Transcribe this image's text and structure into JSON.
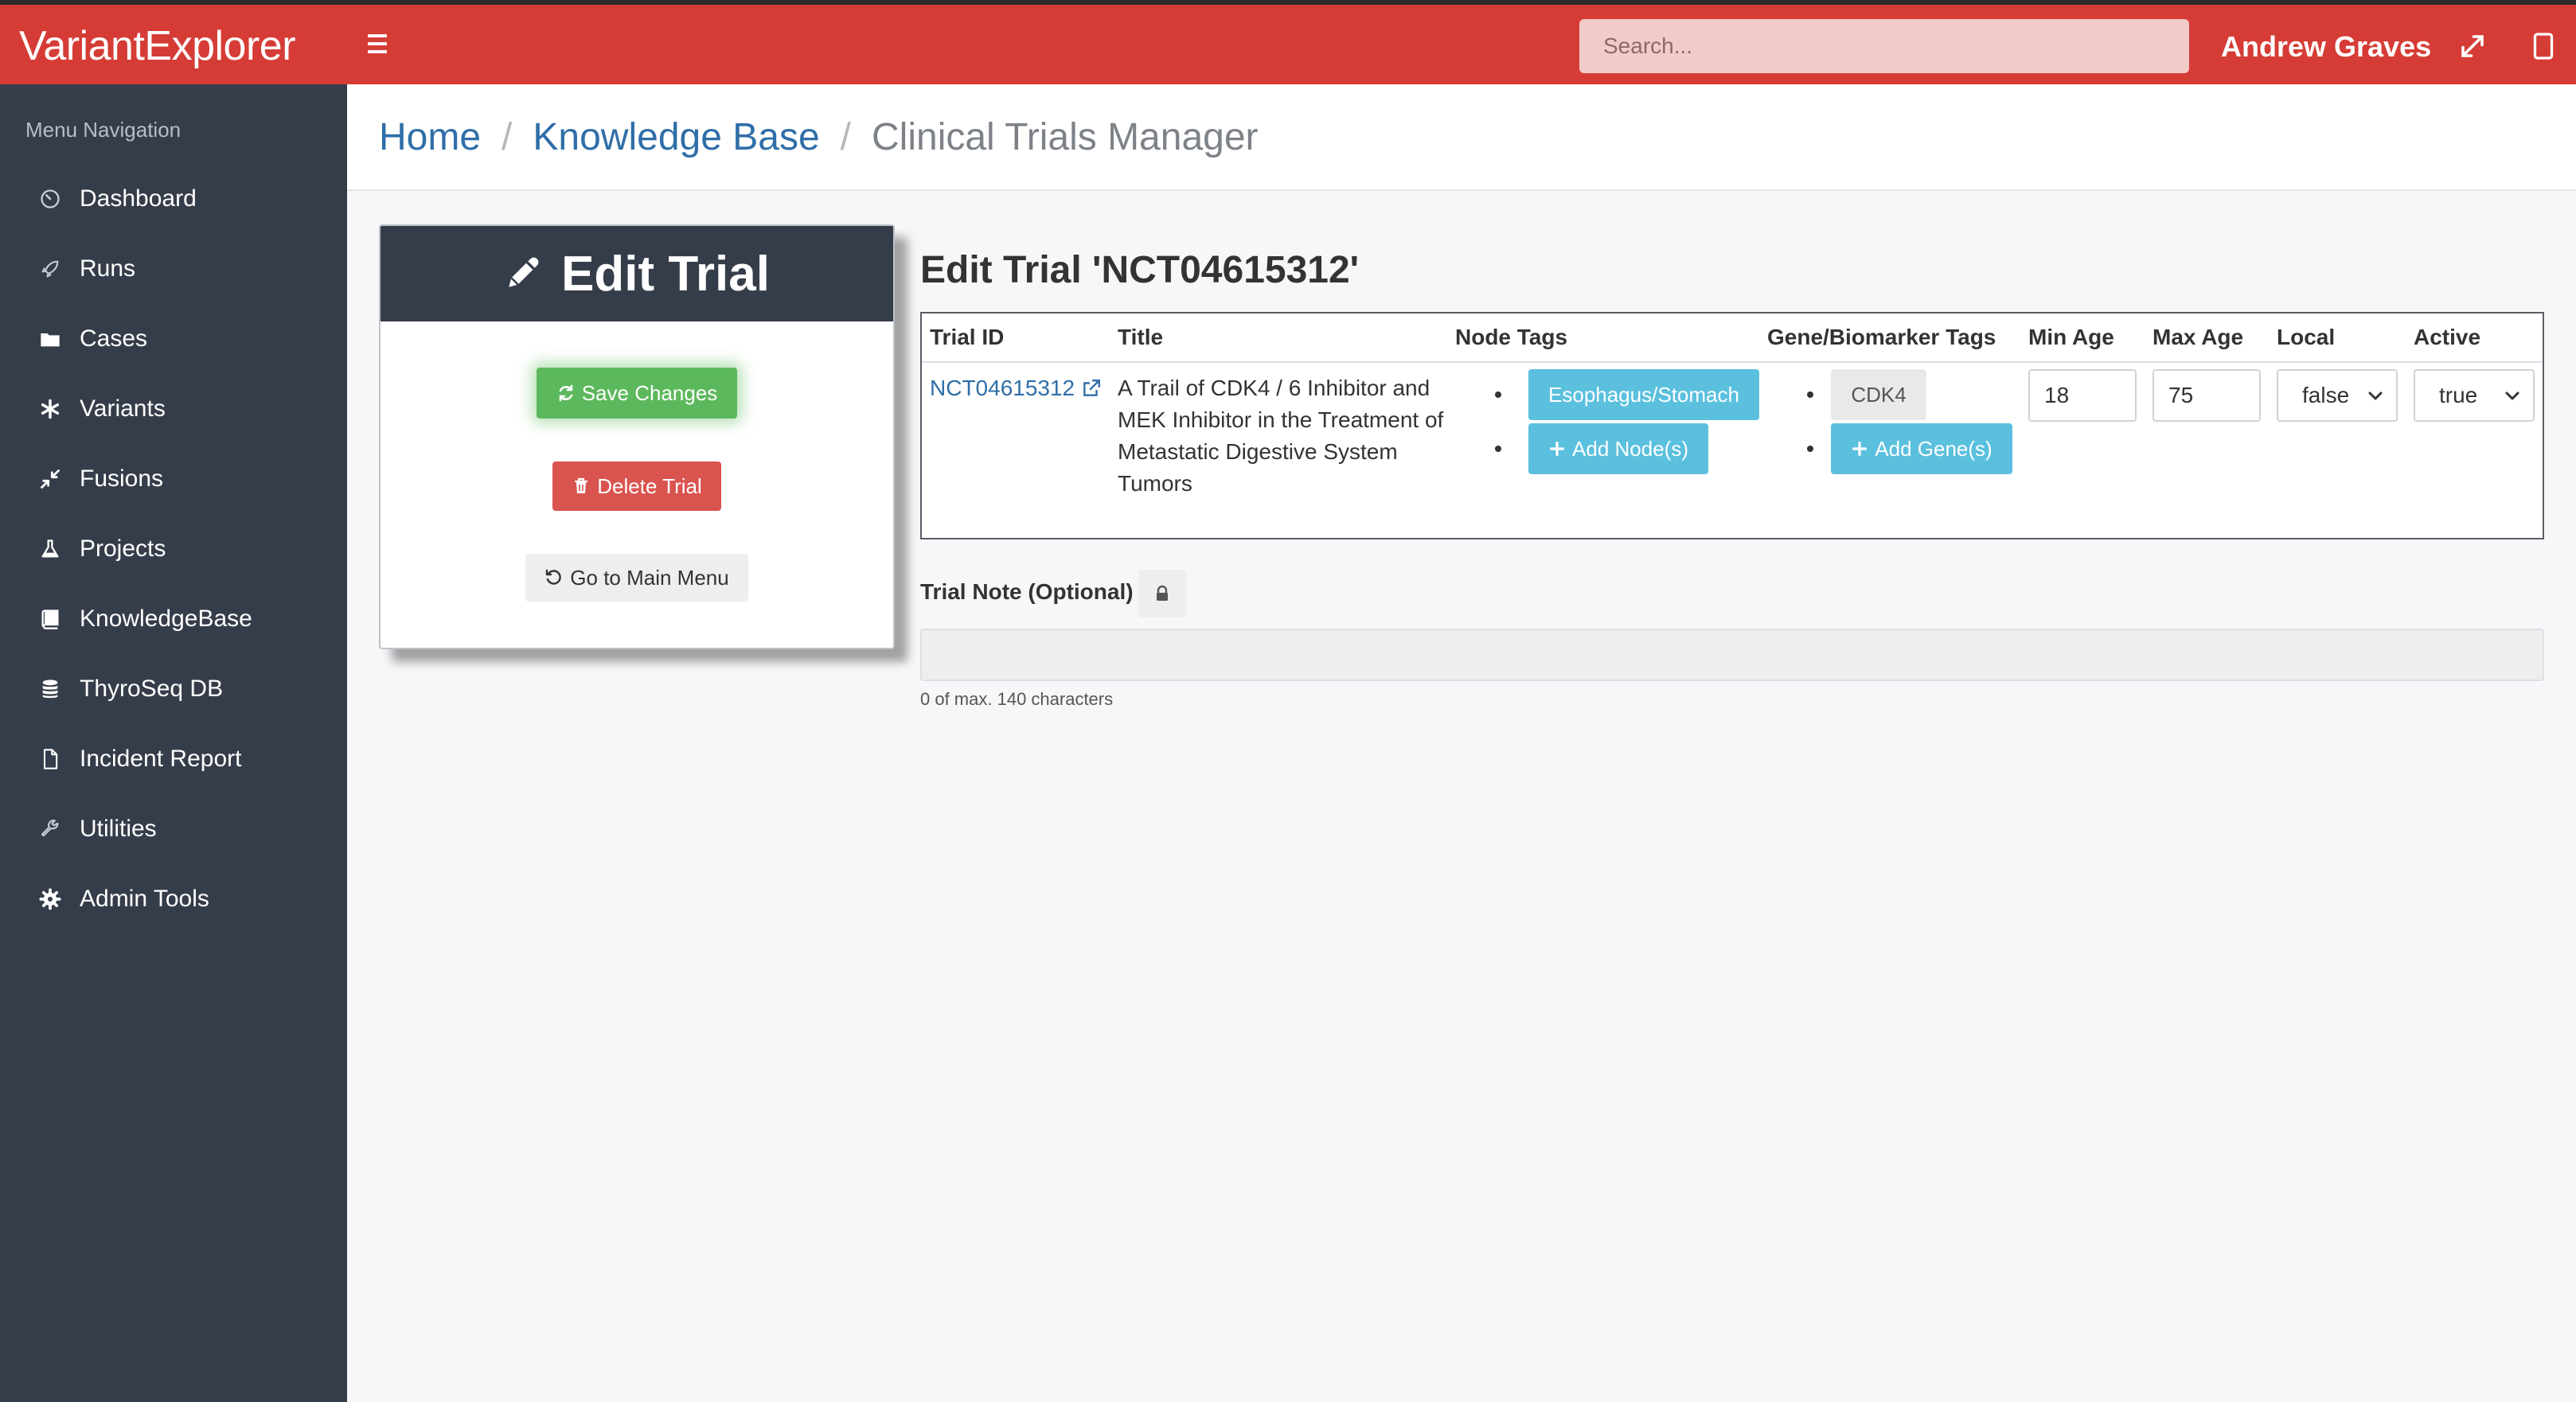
{
  "app": {
    "brand": "VariantExplorer"
  },
  "topbar": {
    "search_placeholder": "Search...",
    "user_name": "Andrew Graves"
  },
  "sidebar": {
    "heading": "Menu Navigation",
    "items": [
      {
        "label": "Dashboard",
        "icon": "dashboard-icon"
      },
      {
        "label": "Runs",
        "icon": "rocket-icon"
      },
      {
        "label": "Cases",
        "icon": "folder-icon"
      },
      {
        "label": "Variants",
        "icon": "asterisk-icon"
      },
      {
        "label": "Fusions",
        "icon": "compress-icon"
      },
      {
        "label": "Projects",
        "icon": "flask-icon"
      },
      {
        "label": "KnowledgeBase",
        "icon": "book-icon"
      },
      {
        "label": "ThyroSeq DB",
        "icon": "database-icon"
      },
      {
        "label": "Incident Report",
        "icon": "file-icon"
      },
      {
        "label": "Utilities",
        "icon": "wrench-icon"
      },
      {
        "label": "Admin Tools",
        "icon": "gear-icon"
      }
    ]
  },
  "breadcrumb": {
    "home": "Home",
    "separator": "/",
    "section": "Knowledge Base",
    "current": "Clinical Trials Manager"
  },
  "edit_card": {
    "title": "Edit Trial",
    "save_label": "Save Changes",
    "delete_label": "Delete Trial",
    "main_menu_label": "Go to Main Menu"
  },
  "trial": {
    "heading": "Edit Trial 'NCT04615312'",
    "columns": [
      "Trial ID",
      "Title",
      "Node Tags",
      "Gene/Biomarker Tags",
      "Min Age",
      "Max Age",
      "Local",
      "Active"
    ],
    "id": "NCT04615312",
    "title": "A Trail of CDK4 / 6 Inhibitor and MEK Inhibitor in the Treatment of Metastatic Digestive System Tumors",
    "node_tag": "Esophagus/Stomach",
    "add_node_label": "Add Node(s)",
    "gene_tag": "CDK4",
    "add_gene_label": "Add Gene(s)",
    "min_age": "18",
    "max_age": "75",
    "local": "false",
    "active": "true"
  },
  "note": {
    "label": "Trial Note (Optional)",
    "value": "",
    "char_count": "0 of max. 140 characters"
  },
  "colors": {
    "topbar": "#d63c36",
    "sidebar": "#363d4a",
    "save": "#5cb85c",
    "delete": "#d9534f",
    "tag": "#5bc0de",
    "link": "#2f6ea8"
  }
}
